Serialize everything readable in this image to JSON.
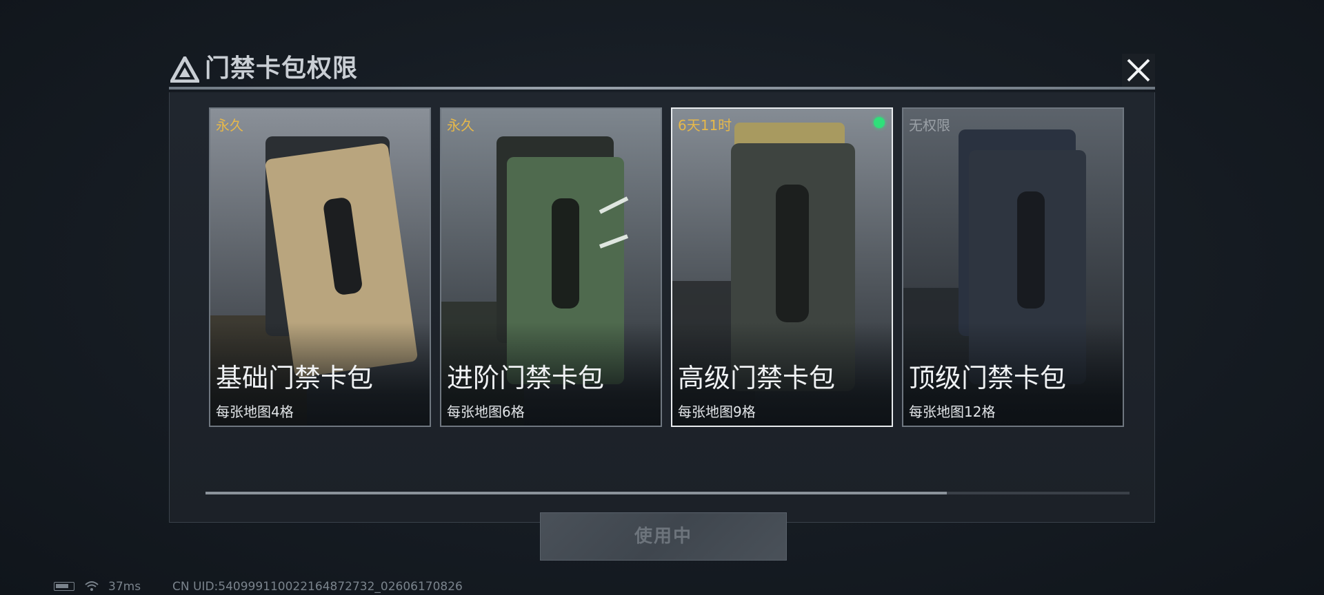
{
  "dialog": {
    "title": "门禁卡包权限",
    "close_icon": "close-icon",
    "logo_icon": "triangle-logo-icon"
  },
  "cards": [
    {
      "tag": "永久",
      "tag_color": "#e6b84a",
      "name": "基础门禁卡包",
      "desc": "每张地图4格",
      "art_color": "#b9a57e",
      "selected": false
    },
    {
      "tag": "永久",
      "tag_color": "#e6b84a",
      "name": "进阶门禁卡包",
      "desc": "每张地图6格",
      "art_color": "#4f6a4e",
      "selected": false
    },
    {
      "tag": "6天11时",
      "tag_color": "#e6b84a",
      "name": "高级门禁卡包",
      "desc": "每张地图9格",
      "art_color": "#3e4440",
      "selected": true,
      "active_dot": true
    },
    {
      "tag": "无权限",
      "tag_color": "#9aa0a6",
      "name": "顶级门禁卡包",
      "desc": "每张地图12格",
      "art_color": "#2e3540",
      "selected": false
    }
  ],
  "action": {
    "use_label": "使用中"
  },
  "scroll": {
    "position_fraction": 0.8
  },
  "status": {
    "ping": "37ms",
    "uid": "CN UID:540999110022164872732_02606170826"
  }
}
